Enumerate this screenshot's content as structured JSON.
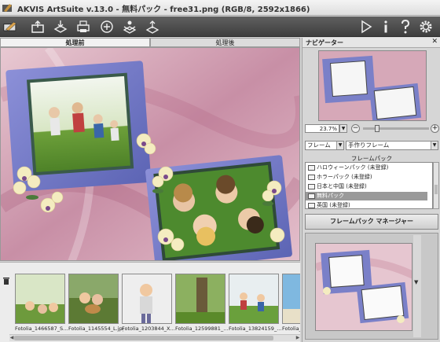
{
  "window": {
    "title": "AKVIS ArtSuite v.13.0 - 無料パック - free31.png (RGB/8, 2592x1866)",
    "minimize": "–",
    "maximize": "□",
    "close": "✕"
  },
  "toolbar": {
    "icons": [
      "brushes-icon",
      "open-file-icon",
      "save-icon",
      "print-icon",
      "share-icon",
      "batch-icon",
      "upload-icon",
      "run-icon",
      "info-icon",
      "help-icon",
      "settings-icon"
    ]
  },
  "tabs": {
    "before": "処理前",
    "after": "処理後"
  },
  "filmstrip": {
    "items": [
      {
        "caption": "Fotolia_1466587_S..."
      },
      {
        "caption": "Fotolia_1145554_L.jpg"
      },
      {
        "caption": "Fotolia_1203844_X..."
      },
      {
        "caption": "Fotolia_12599881_..."
      },
      {
        "caption": "Fotolia_13824159_..."
      },
      {
        "caption": "Fotolia_..."
      }
    ]
  },
  "navigator": {
    "title": "ナビゲーター",
    "close": "✕",
    "zoom": "23.7%",
    "zoom_minus": "−",
    "zoom_plus": "+",
    "zoom_fraction": 0.22
  },
  "settings": {
    "type_select": "フレーム",
    "style_select": "手作りフレーム",
    "pack_label": "フレームパック",
    "packs": [
      {
        "label": "ハロウィーンパック (未登録)",
        "selected": false
      },
      {
        "label": "ホラーパック (未登録)",
        "selected": false
      },
      {
        "label": "日本と中国 (未登録)",
        "selected": false
      },
      {
        "label": "無料パック",
        "selected": true
      },
      {
        "label": "英国 (未登録)",
        "selected": false
      }
    ],
    "manager_button": "フレームパック マネージャー",
    "scroll_arrow": "▼"
  },
  "colors": {
    "toolbar_bg": "#4a4a4a",
    "frame_blue": "#6f78c4",
    "background_pink": "#d8a6b8"
  }
}
